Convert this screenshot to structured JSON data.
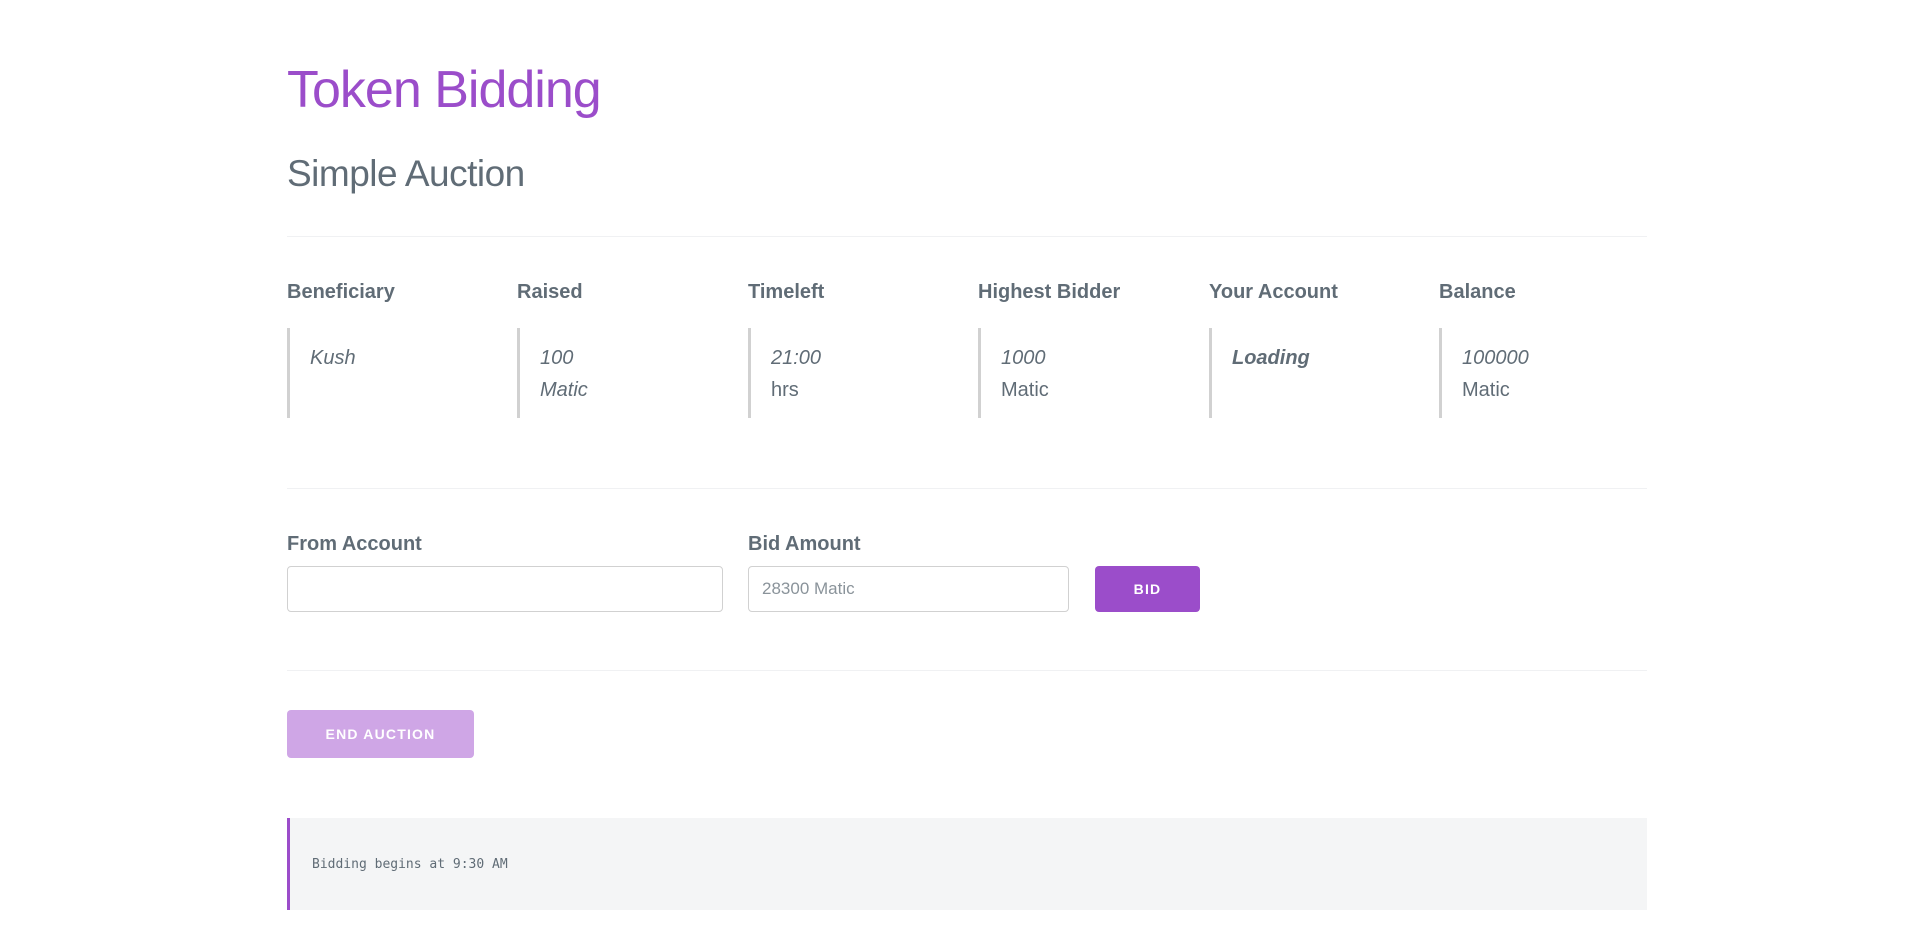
{
  "header": {
    "title": "Token Bidding",
    "subtitle": "Simple Auction"
  },
  "stats": [
    {
      "label": "Beneficiary",
      "value": "Kush",
      "unit": ""
    },
    {
      "label": "Raised",
      "value": "100",
      "unit": "Matic"
    },
    {
      "label": "Timeleft",
      "value": "21:00",
      "unit": "hrs"
    },
    {
      "label": "Highest Bidder",
      "value": "1000",
      "unit": "Matic"
    },
    {
      "label": "Your Account",
      "value": "Loading",
      "unit": ""
    },
    {
      "label": "Balance",
      "value": "100000",
      "unit": "Matic"
    }
  ],
  "form": {
    "from_label": "From Account",
    "from_value": "",
    "amount_label": "Bid Amount",
    "amount_placeholder": "28300 Matic",
    "bid_button": "BID"
  },
  "actions": {
    "end_button": "END AUCTION"
  },
  "log": {
    "message": "Bidding begins at 9:30 AM"
  },
  "colors": {
    "primary": "#9b4dca",
    "primary_disabled": "#cfa6e6",
    "text": "#606c76",
    "log_background": "#f4f5f6"
  }
}
